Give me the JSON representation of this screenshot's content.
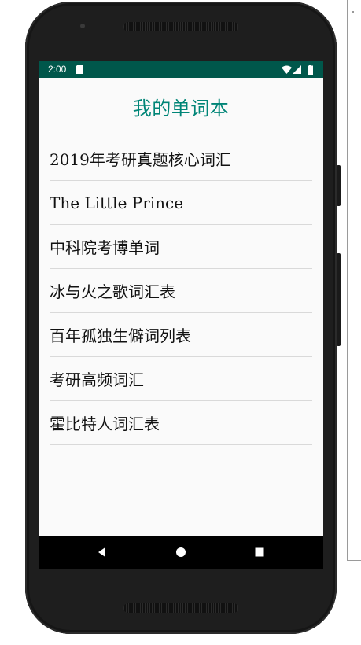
{
  "status_bar": {
    "time": "2:00",
    "icons": [
      "sd-card-icon",
      "wifi-icon",
      "signal-icon",
      "battery-icon"
    ],
    "color": "#00574b"
  },
  "page": {
    "title": "我的单词本",
    "title_color": "#008577"
  },
  "wordbooks": [
    {
      "label": "2019年考研真题核心词汇"
    },
    {
      "label": "The Little Prince"
    },
    {
      "label": "中科院考博单词"
    },
    {
      "label": "冰与火之歌词汇表"
    },
    {
      "label": "百年孤独生僻词列表"
    },
    {
      "label": "考研高频词汇"
    },
    {
      "label": "霍比特人词汇表"
    }
  ],
  "nav_bar": {
    "buttons": [
      "back-icon",
      "home-icon",
      "recents-icon"
    ]
  }
}
